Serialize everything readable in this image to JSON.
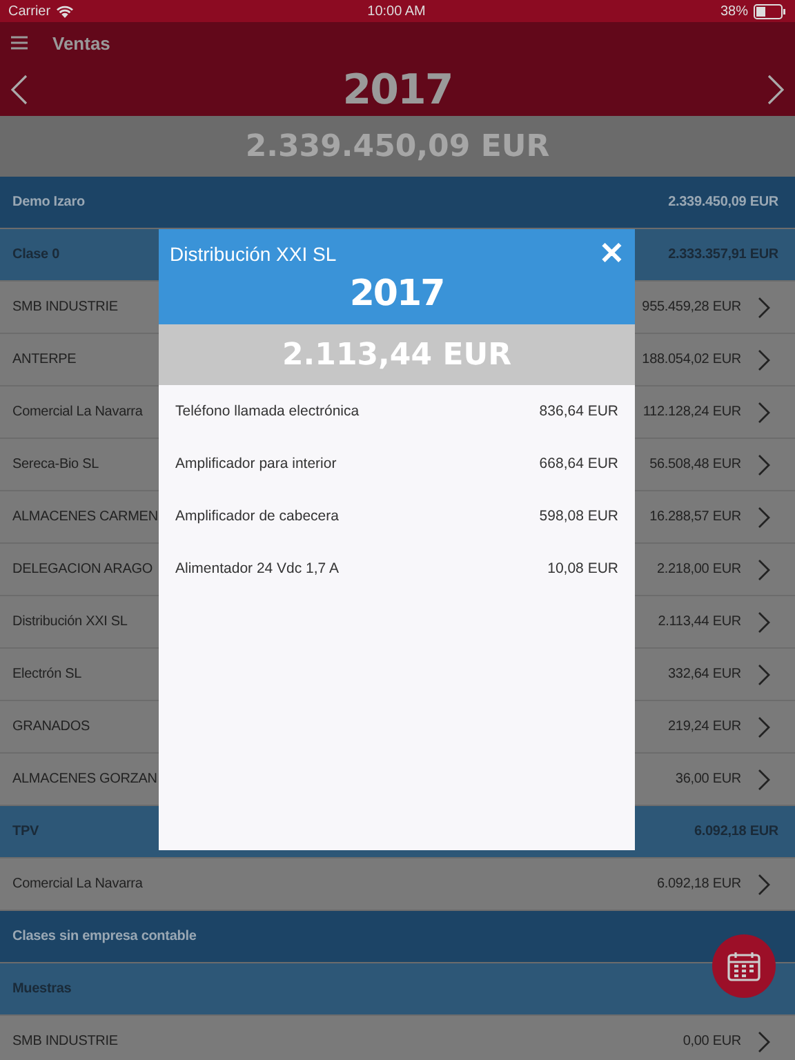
{
  "status_bar": {
    "carrier": "Carrier",
    "time": "10:00 AM",
    "battery": "38%"
  },
  "nav": {
    "title": "Ventas",
    "year": "2017"
  },
  "total": "2.339.450,09 EUR",
  "rows": [
    {
      "kind": "company",
      "label": "Demo Izaro",
      "amount": "2.339.450,09 EUR"
    },
    {
      "kind": "class",
      "label": "Clase 0",
      "amount": "2.333.357,91 EUR"
    },
    {
      "kind": "client",
      "label": "SMB INDUSTRIE",
      "amount": "955.459,28 EUR"
    },
    {
      "kind": "client",
      "label": "ANTERPE",
      "amount": "188.054,02 EUR"
    },
    {
      "kind": "client",
      "label": "Comercial La Navarra",
      "amount": "112.128,24 EUR"
    },
    {
      "kind": "client",
      "label": "Sereca-Bio SL",
      "amount": "56.508,48 EUR"
    },
    {
      "kind": "client",
      "label": "ALMACENES CARMEN",
      "amount": "16.288,57 EUR"
    },
    {
      "kind": "client",
      "label": "DELEGACION ARAGO",
      "amount": "2.218,00 EUR"
    },
    {
      "kind": "client",
      "label": "Distribución XXI SL",
      "amount": "2.113,44 EUR"
    },
    {
      "kind": "client",
      "label": "Electrón SL",
      "amount": "332,64 EUR"
    },
    {
      "kind": "client",
      "label": "GRANADOS",
      "amount": "219,24 EUR"
    },
    {
      "kind": "client",
      "label": "ALMACENES GORZAN",
      "amount": "36,00 EUR"
    },
    {
      "kind": "class",
      "label": "TPV",
      "amount": "6.092,18 EUR"
    },
    {
      "kind": "client",
      "label": "Comercial La Navarra",
      "amount": "6.092,18 EUR"
    },
    {
      "kind": "company",
      "label": "Clases sin empresa contable"
    },
    {
      "kind": "class",
      "label": "Muestras"
    },
    {
      "kind": "client",
      "label": "SMB INDUSTRIE",
      "amount": "0,00 EUR"
    }
  ],
  "modal": {
    "title": "Distribución XXI SL",
    "close": "✕",
    "year": "2017",
    "total": "2.113,44 EUR",
    "items": [
      {
        "name": "Teléfono llamada electrónica",
        "amount": "836,64 EUR"
      },
      {
        "name": "Amplificador para interior",
        "amount": "668,64 EUR"
      },
      {
        "name": "Amplificador de cabecera",
        "amount": "598,08 EUR"
      },
      {
        "name": "Alimentador 24 Vdc 1,7 A",
        "amount": "10,08 EUR"
      }
    ]
  }
}
